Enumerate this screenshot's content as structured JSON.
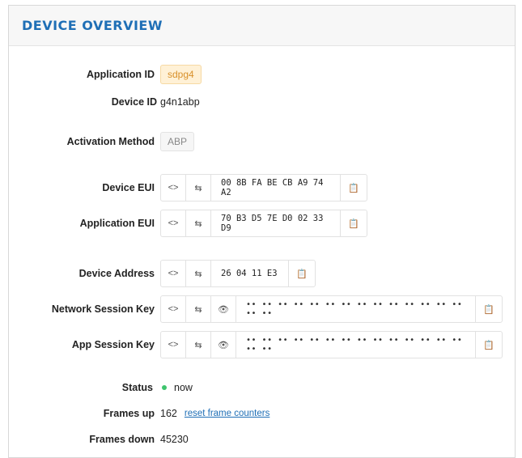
{
  "panel": {
    "title": "DEVICE OVERVIEW"
  },
  "device": {
    "application_id": {
      "label": "Application ID",
      "value": "sdpg4"
    },
    "device_id": {
      "label": "Device ID",
      "value": "g4n1abp"
    },
    "activation": {
      "label": "Activation Method",
      "value": "ABP"
    },
    "device_eui": {
      "label": "Device EUI",
      "value": "00 8B FA BE CB A9 74 A2"
    },
    "app_eui": {
      "label": "Application EUI",
      "value": "70 B3 D5 7E D0 02 33 D9"
    },
    "dev_addr": {
      "label": "Device Address",
      "value": "26 04 11 E3"
    },
    "nwk_skey": {
      "label": "Network Session Key",
      "value": "•• •• •• •• •• •• •• •• •• •• •• •• •• •• •• ••"
    },
    "app_skey": {
      "label": "App Session Key",
      "value": "•• •• •• •• •• •• •• •• •• •• •• •• •• •• •• ••"
    },
    "status": {
      "label": "Status",
      "value": "now",
      "color": "#3ec46d"
    },
    "frames_up": {
      "label": "Frames up",
      "value": "162",
      "link": "reset frame counters"
    },
    "frames_down": {
      "label": "Frames down",
      "value": "45230"
    }
  },
  "icons": {
    "toggle_format": "code-brackets-icon",
    "toggle_order": "swap-bytes-icon",
    "show_key": "eye-icon",
    "copy": "clipboard-icon"
  },
  "glyphs": {
    "brackets": "<>",
    "swap": "⇆",
    "eye": "👁",
    "copy": "📋"
  }
}
